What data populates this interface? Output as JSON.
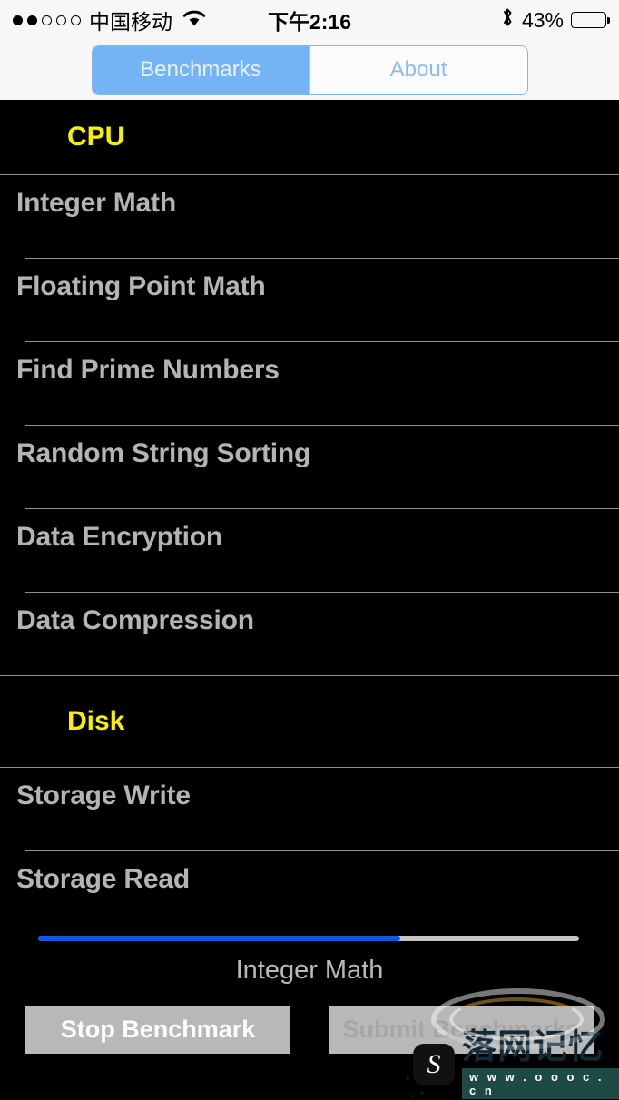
{
  "status_bar": {
    "signal_dots_total": 5,
    "signal_dots_filled": 2,
    "carrier": "中国移动",
    "wifi_icon": "wifi-icon",
    "time": "下午2:16",
    "bluetooth_icon": "bluetooth-icon",
    "battery_percent_label": "43%",
    "battery_level": 43
  },
  "segmented_control": {
    "tabs": [
      {
        "label": "Benchmarks",
        "selected": true
      },
      {
        "label": "About",
        "selected": false
      }
    ],
    "selected_bg": "#74b4f4",
    "selected_text": "#e8f2fd",
    "unselected_text": "#8cbcea"
  },
  "sections": [
    {
      "title": "CPU",
      "title_color": "#f9f000",
      "rows": [
        {
          "label": "Integer Math"
        },
        {
          "label": "Floating Point Math"
        },
        {
          "label": "Find Prime Numbers"
        },
        {
          "label": "Random String Sorting"
        },
        {
          "label": "Data Encryption"
        },
        {
          "label": "Data Compression"
        }
      ]
    },
    {
      "title": "Disk",
      "title_color": "#f9f000",
      "rows": [
        {
          "label": "Storage Write"
        },
        {
          "label": "Storage Read"
        }
      ]
    }
  ],
  "progress": {
    "percent": 67,
    "current_task_label": "Integer Math",
    "fill_color": "#1158e0",
    "track_color": "#c9c5c0"
  },
  "buttons": {
    "stop": {
      "label": "Stop Benchmark",
      "enabled": true
    },
    "submit": {
      "label": "Submit Benchmarks",
      "enabled": false
    }
  },
  "watermark": {
    "logo_glyph": "S",
    "title": "落网记忆",
    "url": "w w w . o o o c . c n"
  }
}
